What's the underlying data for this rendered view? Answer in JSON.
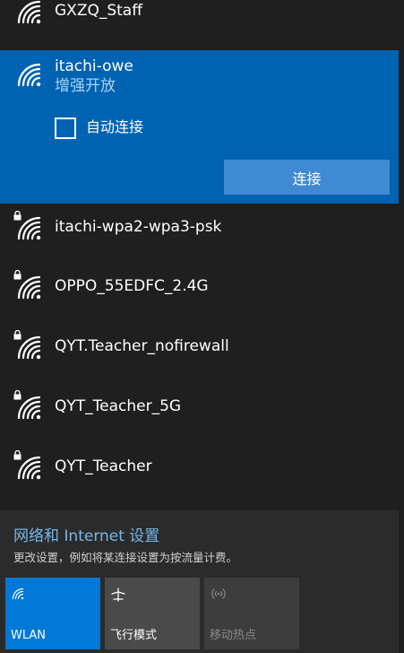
{
  "networks": [
    {
      "name": "GXZQ_Staff",
      "secured": false
    },
    {
      "name": "itachi-owe",
      "status": "增强开放",
      "secured": false,
      "selected": true
    },
    {
      "name": "itachi-wpa2-wpa3-psk",
      "secured": true
    },
    {
      "name": "OPPO_55EDFC_2.4G",
      "secured": true
    },
    {
      "name": "QYT.Teacher_nofirewall",
      "secured": true
    },
    {
      "name": "QYT_Teacher_5G",
      "secured": true
    },
    {
      "name": "QYT_Teacher",
      "secured": true
    }
  ],
  "selected": {
    "auto_connect_label": "自动连接",
    "auto_connect_checked": false,
    "connect_label": "连接"
  },
  "settings": {
    "link": "网络和 Internet 设置",
    "description": "更改设置，例如将某连接设置为按流量计费。"
  },
  "quick_actions": [
    {
      "label": "WLAN",
      "icon": "wifi-icon",
      "state": "on"
    },
    {
      "label": "飞行模式",
      "icon": "airplane-icon",
      "state": "off"
    },
    {
      "label": "移动热点",
      "icon": "hotspot-icon",
      "state": "disabled"
    }
  ],
  "colors": {
    "background": "#1f1f1f",
    "selected_bg": "#0063b1",
    "accent_tile": "#0078d7",
    "link": "#77b6e6"
  }
}
